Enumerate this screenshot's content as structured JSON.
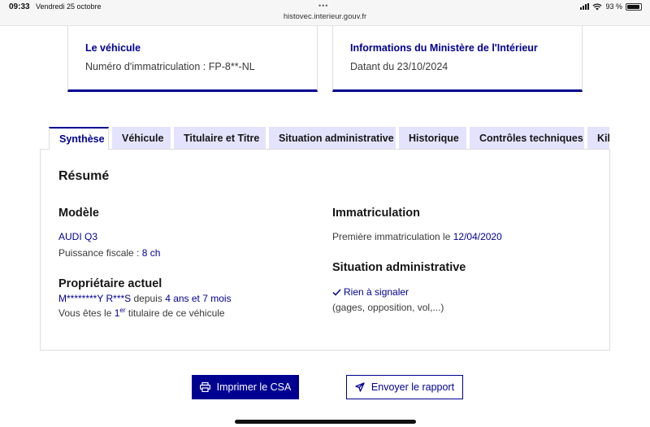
{
  "statusbar": {
    "time": "09:33",
    "date": "Vendredi 25 octobre",
    "url": "histovec.interieur.gouv.fr",
    "battery": "93 %"
  },
  "cards": {
    "vehicle": {
      "title": "Le véhicule",
      "subtitle": "Numéro d'immatriculation : FP-8**-NL"
    },
    "ministry": {
      "title": "Informations du Ministère de l'Intérieur",
      "subtitle": "Datant du 23/10/2024"
    }
  },
  "tabs": [
    {
      "label": "Synthèse",
      "active": true
    },
    {
      "label": "Véhicule",
      "active": false
    },
    {
      "label": "Titulaire et Titre",
      "active": false
    },
    {
      "label": "Situation administrative",
      "active": false
    },
    {
      "label": "Historique",
      "active": false
    },
    {
      "label": "Contrôles techniques",
      "active": false
    },
    {
      "label": "Kilométrage",
      "active": false
    }
  ],
  "summary": {
    "title": "Résumé",
    "model": {
      "heading": "Modèle",
      "name": "AUDI Q3",
      "power_label": "Puissance fiscale : ",
      "power_value": "8 ch"
    },
    "owner": {
      "heading": "Propriétaire actuel",
      "name": "M********Y R***S",
      "since_label": " depuis ",
      "since_value": "4 ans et 7 mois",
      "rank_prefix": "Vous êtes le ",
      "rank_number": "1",
      "rank_sup": "er",
      "rank_suffix": " titulaire de ce véhicule"
    },
    "registration": {
      "heading": "Immatriculation",
      "label": "Première immatriculation le ",
      "date": "12/04/2020"
    },
    "admin": {
      "heading": "Situation administrative",
      "status": "Rien à signaler",
      "detail": "(gages, opposition, vol,...)"
    }
  },
  "actions": {
    "print_label": "Imprimer le CSA",
    "send_label": "Envoyer le rapport"
  },
  "colors": {
    "primary": "#000091",
    "tab_inactive": "#e3e3fd"
  }
}
